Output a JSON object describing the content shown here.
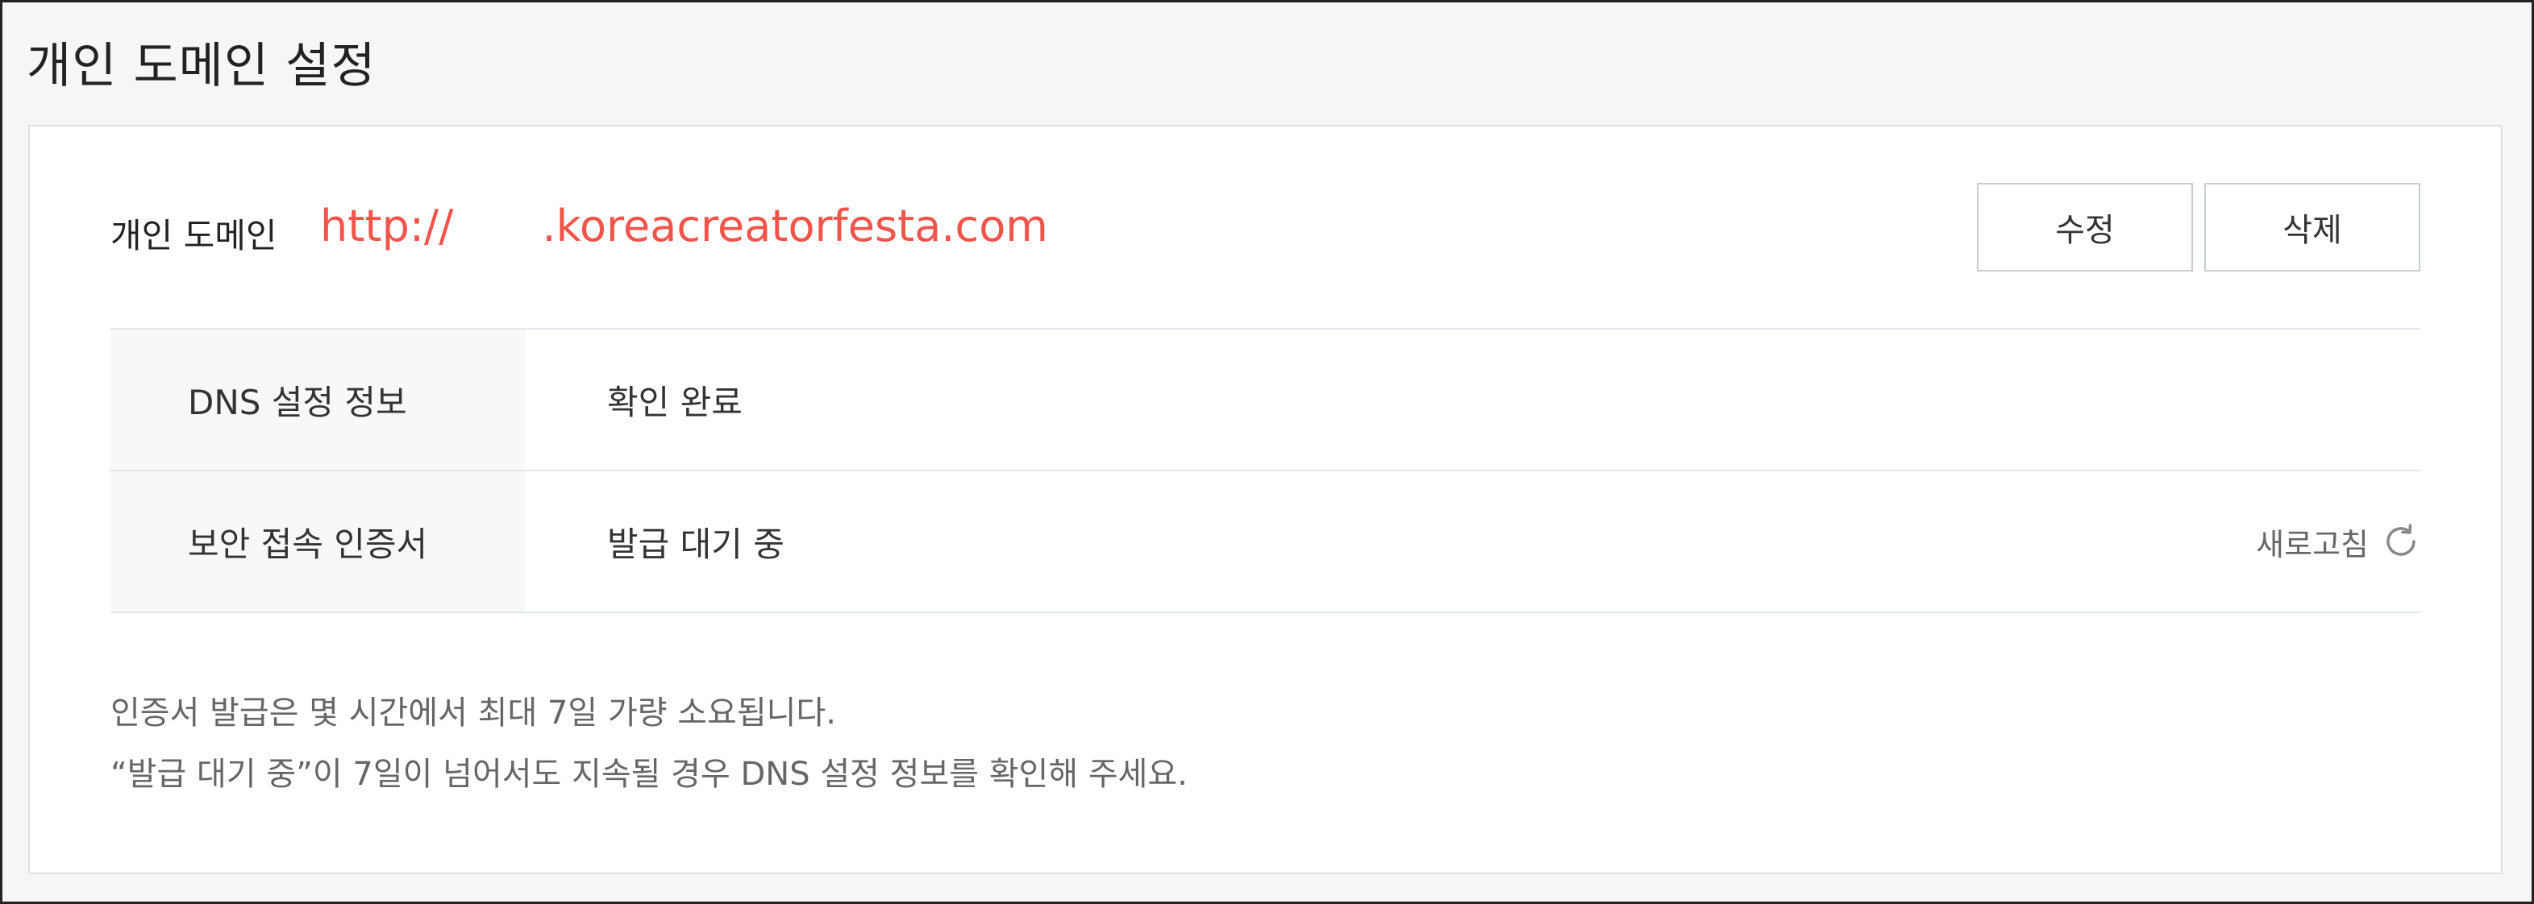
{
  "page": {
    "title": "개인 도메인 설정"
  },
  "domain": {
    "label": "개인 도메인",
    "url_prefix": "http://",
    "url_suffix": ".koreacreatorfesta.com",
    "url_color": "#f2544a"
  },
  "buttons": {
    "edit_label": "수정",
    "delete_label": "삭제"
  },
  "info": {
    "rows": [
      {
        "key": "DNS 설정 정보",
        "value": "확인 완료"
      },
      {
        "key": "보안 접속 인증서",
        "value": "발급 대기 중"
      }
    ],
    "refresh_label": "새로고침",
    "refresh_icon": "refresh-icon"
  },
  "notes": {
    "line1": "인증서 발급은 몇 시간에서 최대 7일 가량 소요됩니다.",
    "line2": "“발급 대기 중”이 7일이 넘어서도 지속될 경우 DNS 설정 정보를 확인해 주세요."
  }
}
